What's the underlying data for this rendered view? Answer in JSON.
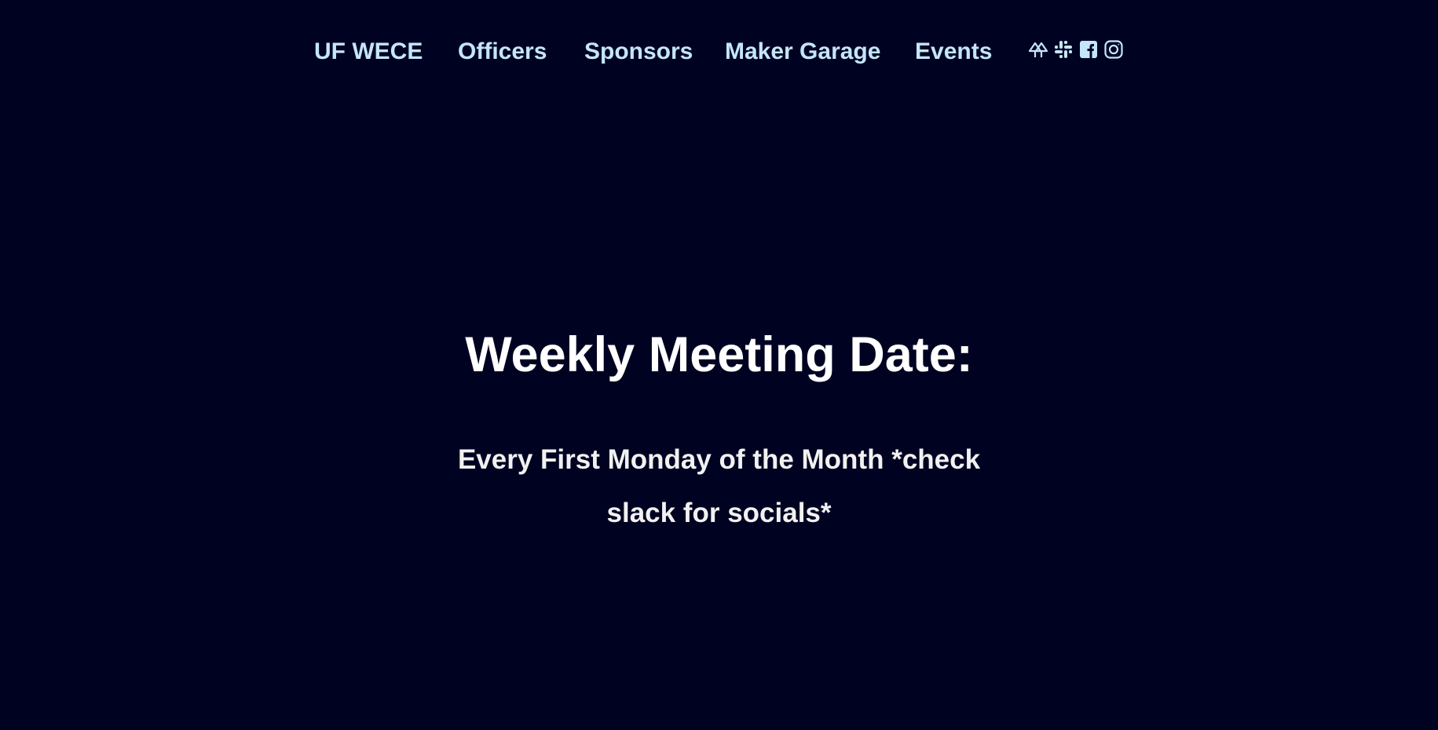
{
  "nav": {
    "brand": "UF WECE",
    "items": [
      "Officers",
      "Sponsors",
      "Maker Garage",
      "Events"
    ],
    "icons": [
      "linktree-icon",
      "slack-icon",
      "facebook-icon",
      "instagram-icon"
    ],
    "link_color": "#c4e6fb"
  },
  "hero": {
    "title": "Weekly Meeting Date:",
    "subtitle_line1": "Every First Monday of the Month *check",
    "subtitle_line2": "slack for socials*"
  },
  "colors": {
    "background": "#000221",
    "heading": "#ffffff"
  }
}
